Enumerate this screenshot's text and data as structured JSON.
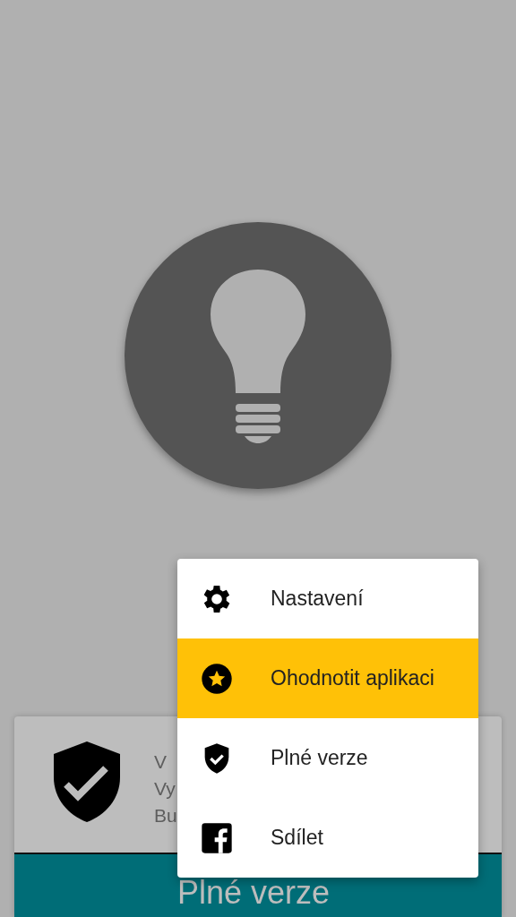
{
  "promo_card": {
    "title": "V",
    "lines": [
      "Vy",
      "Bu"
    ],
    "button": "Plné verze"
  },
  "menu": {
    "items": [
      {
        "label": "Nastavení",
        "selected": false
      },
      {
        "label": "Ohodnotit aplikaci",
        "selected": true
      },
      {
        "label": "Plné verze",
        "selected": false
      },
      {
        "label": "Sdílet",
        "selected": false
      }
    ]
  }
}
